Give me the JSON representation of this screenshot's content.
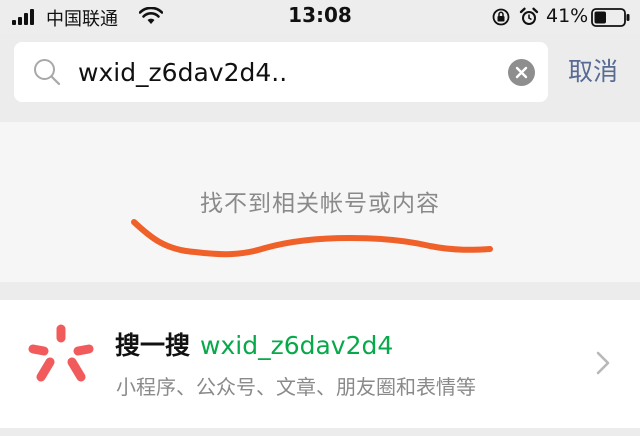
{
  "status_bar": {
    "carrier": "中国联通",
    "time": "13:08",
    "battery_percent": "41%",
    "battery_level": 0.41,
    "icons": [
      "signal-icon",
      "wifi-icon",
      "rotation-lock-icon",
      "alarm-icon",
      "battery-icon"
    ]
  },
  "search": {
    "query": "wxid_z6dav2d4..",
    "cancel_label": "取消",
    "icons": [
      "search-icon",
      "clear-icon"
    ]
  },
  "no_result": {
    "message": "找不到相关帐号或内容",
    "scribble_color": "#f0612a"
  },
  "sou_yi_sou": {
    "title": "搜一搜",
    "query": "wxid_z6dav2d4",
    "subtitle": "小程序、公众号、文章、朋友圈和表情等",
    "query_color": "#07a94a",
    "logo_color": "#f15b5b",
    "icons": [
      "sou-yi-sou-logo-icon",
      "chevron-right-icon"
    ]
  },
  "colors": {
    "link_blue": "#576b95",
    "background": "#ececec"
  }
}
